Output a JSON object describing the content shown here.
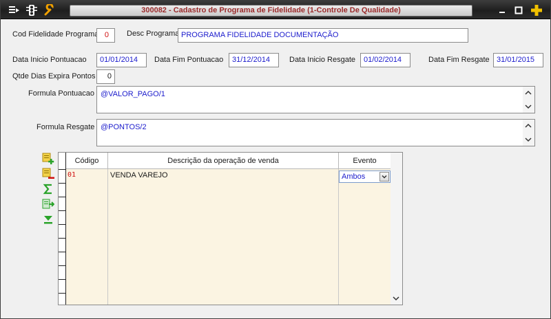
{
  "window": {
    "title": "300082 - Cadastro de Programa de Fidelidade (1-Controle De Qualidade)"
  },
  "form": {
    "cod_label": "Cod Fidelidade Programa",
    "cod_value": "0",
    "desc_label": "Desc Programa",
    "desc_value": "PROGRAMA FIDELIDADE DOCUMENTAÇÃO",
    "data_inicio_pont_label": "Data Inicio Pontuacao",
    "data_inicio_pont_value": "01/01/2014",
    "data_fim_pont_label": "Data Fim Pontuacao",
    "data_fim_pont_value": "31/12/2014",
    "data_inicio_resg_label": "Data Inicio Resgate",
    "data_inicio_resg_value": "01/02/2014",
    "data_fim_resg_label": "Data Fim Resgate",
    "data_fim_resg_value": "31/01/2015",
    "qtde_dias_label": "Qtde Dias Expira Pontos",
    "qtde_dias_value": "0",
    "formula_pont_label": "Formula Pontuacao",
    "formula_pont_value": "@VALOR_PAGO/1",
    "formula_resg_label": "Formula Resgate",
    "formula_resg_value": "@PONTOS/2"
  },
  "grid": {
    "columns": [
      "Código",
      "Descrição da operação de venda",
      "Evento"
    ],
    "rows": [
      {
        "codigo": "01",
        "descricao": "VENDA VAREJO",
        "evento": "Ambos"
      }
    ]
  },
  "icons": {
    "titlebar_left": [
      "menu-icon",
      "traffic-light-icon",
      "wrench-icon"
    ],
    "titlebar_right": [
      "minimize-icon",
      "maximize-icon",
      "plus-icon"
    ],
    "side_toolbar": [
      "add-row-icon",
      "delete-row-icon",
      "sum-icon",
      "export-icon",
      "move-down-icon"
    ]
  },
  "colors": {
    "title_text": "#9a2a2a",
    "value_text": "#1a1acc",
    "grid_background": "#fbf4e2",
    "plus_icon": "#f0c000"
  }
}
